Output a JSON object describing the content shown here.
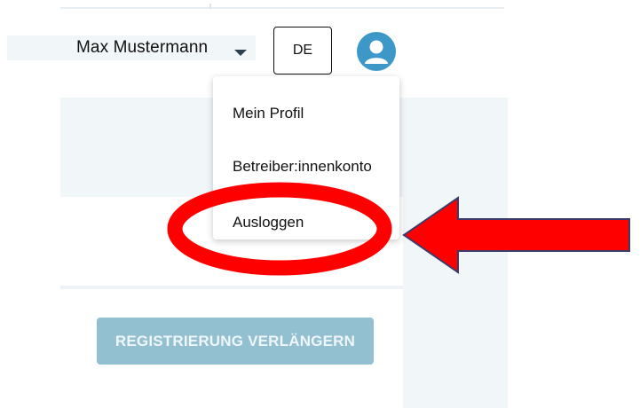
{
  "header": {
    "user_name": "Max Mustermann",
    "language_button": "DE",
    "avatar_icon": "user-circle-icon"
  },
  "dropdown": {
    "items": [
      {
        "label": "Mein Profil"
      },
      {
        "label": "Betreiber:innenkonto"
      },
      {
        "label": "Ausloggen"
      }
    ]
  },
  "main": {
    "register_button": "REGISTRIERUNG VERLÄNGERN"
  },
  "annotations": {
    "highlight_color": "#ff0000",
    "arrow_color": "#ff0000",
    "arrow_outline_color": "#3b3b6b"
  },
  "colors": {
    "panel_bg": "#f1f6f9",
    "avatar_blue": "#3d98c8",
    "button_bg": "#93c0d1"
  }
}
